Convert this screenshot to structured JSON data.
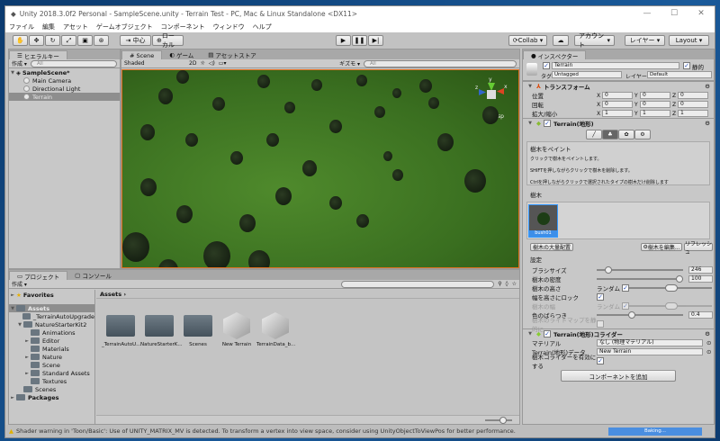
{
  "window": {
    "title": "Unity 2018.3.0f2 Personal - SampleScene.unity - Terrain Test - PC, Mac & Linux Standalone <DX11>",
    "controls": [
      "—",
      "☐",
      "✕"
    ]
  },
  "menu": [
    "ファイル",
    "編集",
    "アセット",
    "ゲームオブジェクト",
    "コンポーネント",
    "ウィンドウ",
    "ヘルプ"
  ],
  "toolbar": {
    "pivot": "中心",
    "space": "ローカル",
    "collab": "Collab",
    "account": "アカウント",
    "layers": "レイヤー",
    "layout": "Layout"
  },
  "hierarchy": {
    "tab": "ヒエラルキー",
    "create": "作成",
    "search_placeholder": "All",
    "scene": "SampleScene*",
    "items": [
      "Main Camera",
      "Directional Light",
      "Terrain"
    ]
  },
  "scene": {
    "tabs": [
      "Scene",
      "ゲーム",
      "アセットストア"
    ],
    "shading": "Shaded",
    "mode_2d": "2D",
    "gizmos": "ギズモ",
    "search_placeholder": "All",
    "persp": "< Persp",
    "axes": {
      "y": "y",
      "x": "x",
      "z": "z"
    }
  },
  "inspector": {
    "tab": "インスペクター",
    "object_name": "Terrain",
    "static_label": "静的",
    "tag_label": "タグ",
    "tag": "Untagged",
    "layer_label": "レイヤー",
    "layer": "Default",
    "transform": {
      "title": "トランスフォーム",
      "rows": [
        {
          "label": "位置",
          "x": "0",
          "y": "0",
          "z": "0"
        },
        {
          "label": "回転",
          "x": "0",
          "y": "0",
          "z": "0"
        },
        {
          "label": "拡大/縮小",
          "x": "1",
          "y": "1",
          "z": "1"
        }
      ]
    },
    "terrain": {
      "title": "Terrain(地形)",
      "help_title": "樹木をペイント",
      "help_lines": [
        "クリックで樹木をペイントします。",
        "SHIFTを押しながらクリックで樹木を削除します。",
        "Ctrlを押しながらクリックで選択されたタイプの樹木だけ削除します"
      ],
      "trees_label": "樹木",
      "tree_item": "bush01",
      "mass_place": "樹木の大量配置",
      "edit_trees": "樹木を編集...",
      "refresh": "リフレッシュ",
      "settings_label": "設定",
      "settings": [
        {
          "label": "ブラシサイズ",
          "value": "246",
          "fraction": 0.1
        },
        {
          "label": "樹木の密度",
          "value": "100",
          "fraction": 1.0
        }
      ],
      "tree_height": "樹木の高さ",
      "random": "ランダム",
      "lock_width": "幅を高さにロック",
      "tree_width": "樹木の幅",
      "color_variation": {
        "label": "色のばらつき",
        "value": "0.4",
        "fraction": 0.4
      },
      "lightmap_static": "樹木のライトマップを静的に"
    },
    "collider": {
      "title": "Terrain(地形)コライダー",
      "material_label": "マテリアル",
      "material": "なし (物理マテリアル)",
      "data_label": "Terrain(地形)データ",
      "data": "New Terrain",
      "enable_trees": "樹木コライダーを有効にする"
    },
    "add_component": "コンポーネントを追加"
  },
  "project": {
    "tabs": [
      "プロジェクト",
      "コンソール"
    ],
    "create": "作成",
    "favorites": "Favorites",
    "breadcrumb": "Assets",
    "tree": [
      {
        "label": "Assets",
        "depth": 0,
        "fold": "▼",
        "sel": true
      },
      {
        "label": "_TerrainAutoUpgrade",
        "depth": 1,
        "fold": ""
      },
      {
        "label": "NatureStarterKit2",
        "depth": 1,
        "fold": "▼"
      },
      {
        "label": "Animations",
        "depth": 2,
        "fold": ""
      },
      {
        "label": "Editor",
        "depth": 2,
        "fold": "►"
      },
      {
        "label": "Materials",
        "depth": 2,
        "fold": ""
      },
      {
        "label": "Nature",
        "depth": 2,
        "fold": "►"
      },
      {
        "label": "Scene",
        "depth": 2,
        "fold": ""
      },
      {
        "label": "Standard Assets",
        "depth": 2,
        "fold": "►"
      },
      {
        "label": "Textures",
        "depth": 2,
        "fold": ""
      },
      {
        "label": "Scenes",
        "depth": 1,
        "fold": ""
      },
      {
        "label": "Packages",
        "depth": 0,
        "fold": "►"
      }
    ],
    "assets": [
      {
        "label": "_TerrainAutoU...",
        "kind": "folder"
      },
      {
        "label": "NatureStarterK...",
        "kind": "folder"
      },
      {
        "label": "Scenes",
        "kind": "folder"
      },
      {
        "label": "New Terrain",
        "kind": "asset"
      },
      {
        "label": "TerrainData_b...",
        "kind": "asset"
      }
    ]
  },
  "status": {
    "message": "Shader warning in 'Toon/Basic': Use of UNITY_MATRIX_MV is detected. To transform a vertex into view space, consider using UnityObjectToViewPos for better performance.",
    "baking": "Baking..."
  }
}
